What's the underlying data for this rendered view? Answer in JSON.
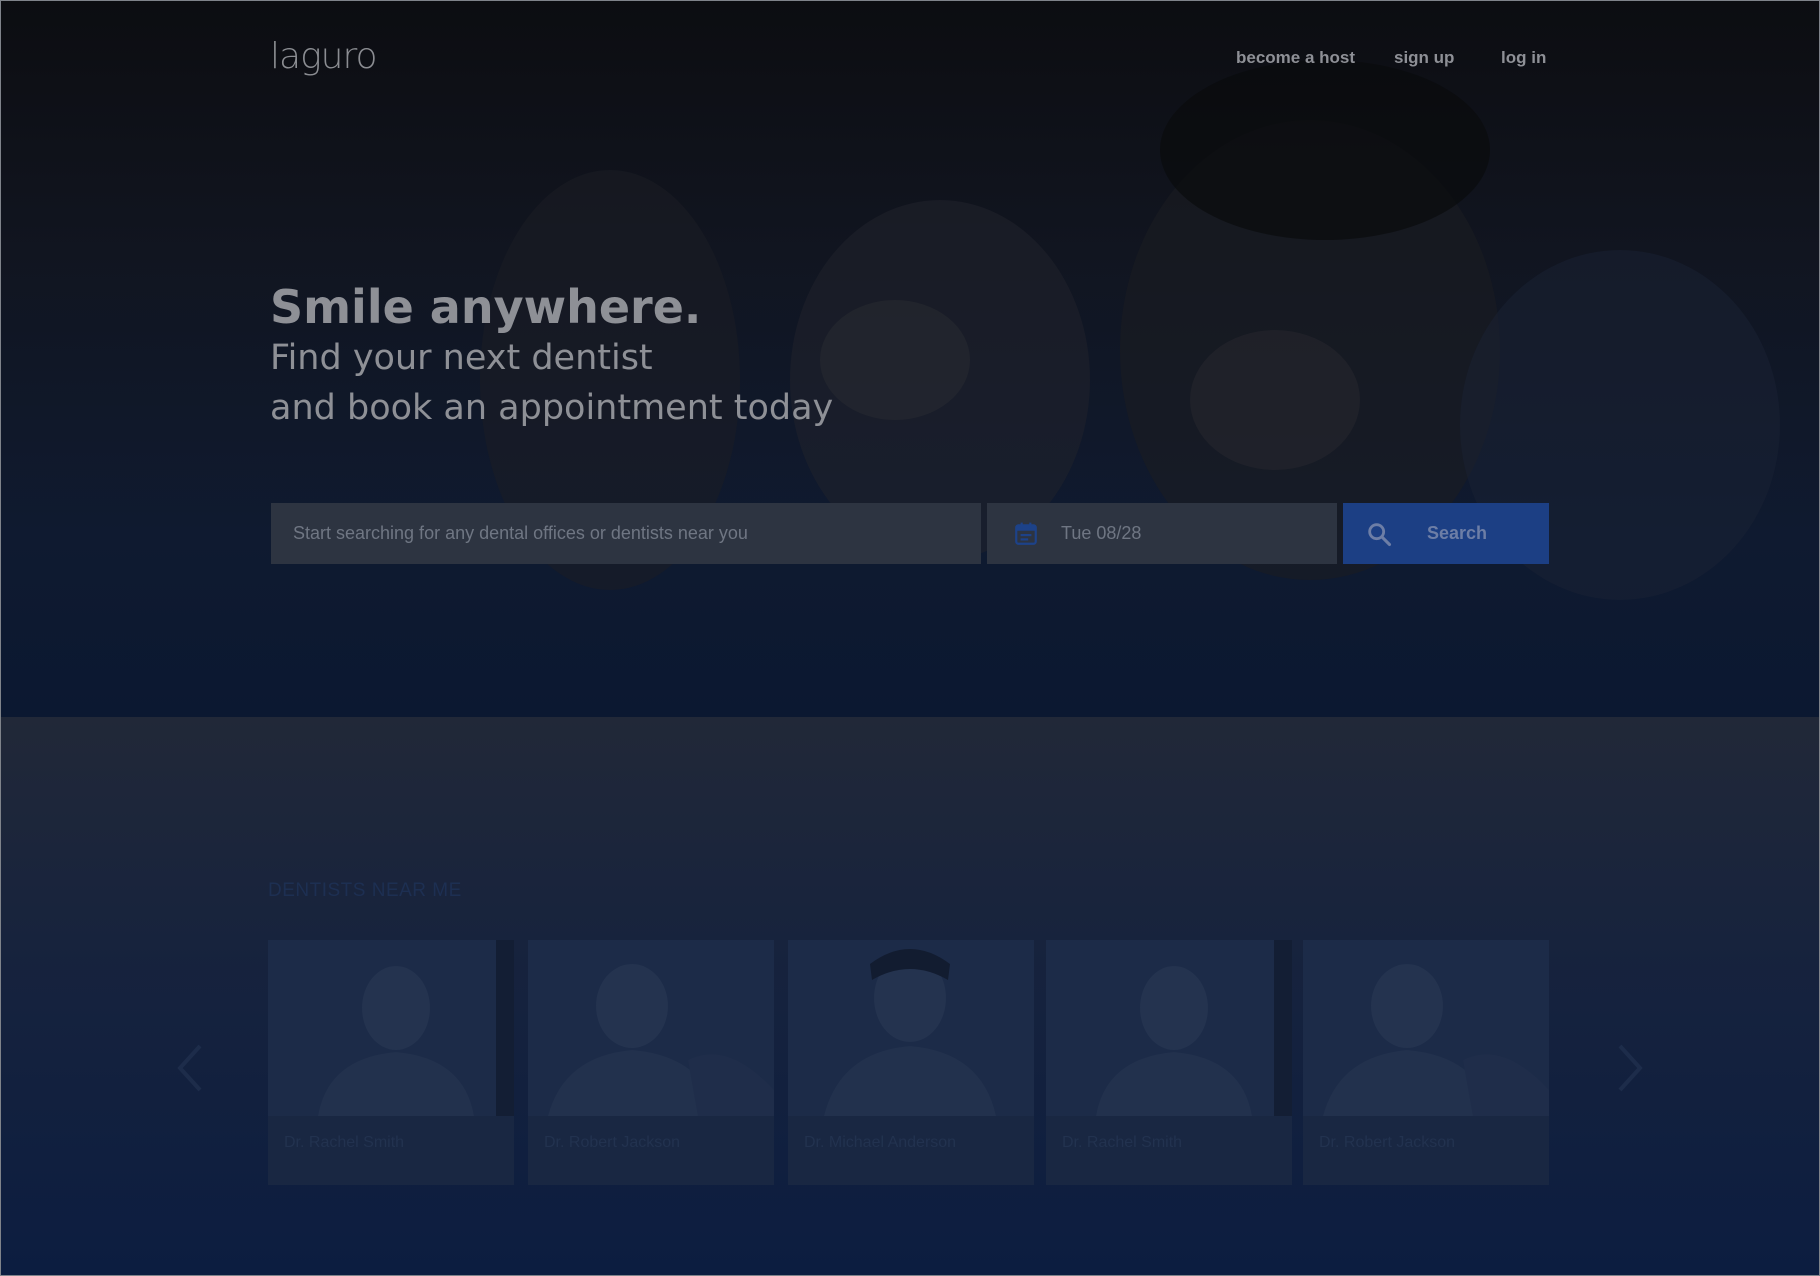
{
  "header": {
    "logo": "laguro",
    "nav": {
      "become_host": "become a host",
      "sign_up": "sign up",
      "log_in": "log in"
    }
  },
  "hero": {
    "headline": "Smile anywhere.",
    "subline_1": "Find your next dentist",
    "subline_2": "and book an appointment today"
  },
  "search": {
    "placeholder": "Start searching for any dental offices or dentists near you",
    "date_value": "Tue  08/28",
    "button_label": "Search"
  },
  "dentists": {
    "section_title": "DENTISTS NEAR ME",
    "cards": [
      {
        "name": "Dr. Rachel Smith"
      },
      {
        "name": "Dr. Robert Jackson"
      },
      {
        "name": "Dr. Michael Anderson"
      },
      {
        "name": "Dr. Rachel Smith"
      },
      {
        "name": "Dr. Robert Jackson"
      }
    ]
  },
  "colors": {
    "accent": "#1c3f84",
    "hero_overlay": "#0f1a30",
    "field_bg": "#2d3441"
  },
  "icons": {
    "calendar": "calendar-icon",
    "search": "search-icon",
    "prev": "chevron-left-icon",
    "next": "chevron-right-icon"
  }
}
